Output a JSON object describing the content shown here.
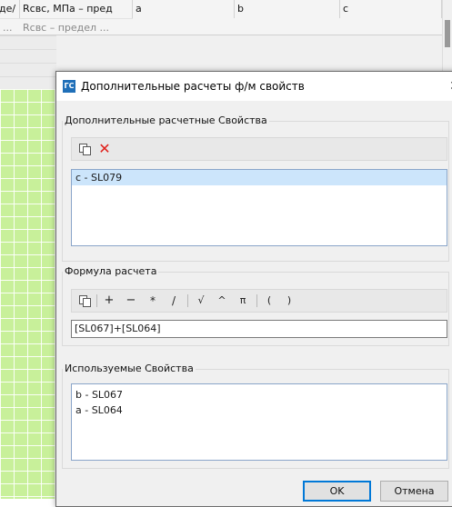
{
  "grid": {
    "headers": [
      "де/",
      "Rсвс, МПа – пред",
      "a",
      "b",
      "c"
    ],
    "subheaders": [
      "...",
      "Rсвс – предел ..."
    ]
  },
  "dialog": {
    "app_icon": "ГС",
    "title": "Дополнительные расчеты ф/м свойств",
    "close_glyph": "✕"
  },
  "extra_props": {
    "title": "Дополнительные расчетные Свойства",
    "copy_icon": "copy-icon",
    "delete_glyph": "✕",
    "items": [
      "c - SL079"
    ]
  },
  "formula": {
    "title": "Формула расчета",
    "ops": [
      "+",
      "−",
      "*",
      "/",
      "√",
      "^",
      "π",
      "(",
      ")"
    ],
    "value": "[SL067]+[SL064]"
  },
  "used_props": {
    "title": "Используемые Свойства",
    "items": [
      "b - SL067",
      "a - SL064"
    ]
  },
  "buttons": {
    "ok": "OK",
    "cancel": "Отмена"
  },
  "colors": {
    "accent": "#0078d7",
    "delete_red": "#e0201a",
    "green_cells": "#c8f09a",
    "selection": "#cce5fb"
  }
}
